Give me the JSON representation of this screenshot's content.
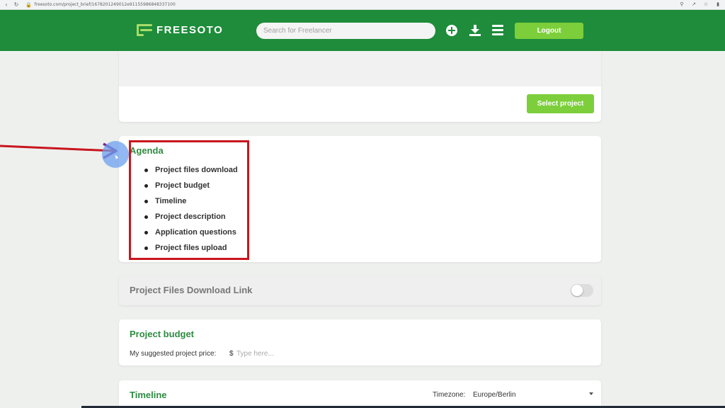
{
  "browser": {
    "url": "freesoto.com/project_brief/1678201249012e91155986848337100",
    "icons": [
      "back-icon",
      "reload-icon",
      "lock-icon",
      "zoom-icon",
      "share-icon",
      "star-icon",
      "sidebar-icon"
    ]
  },
  "header": {
    "logo_text": "FREESOTO",
    "search_placeholder": "Search for Freelancer",
    "logout_label": "Logout",
    "icons": [
      "plus-icon",
      "download-icon",
      "menu-icon"
    ]
  },
  "top_card": {
    "select_project_label": "Select project"
  },
  "agenda": {
    "title": "Agenda",
    "items": [
      "Project files download",
      "Project budget",
      "Timeline",
      "Project description",
      "Application questions",
      "Project files upload"
    ]
  },
  "download_link": {
    "title": "Project Files Download Link",
    "toggle_on": false
  },
  "budget": {
    "title": "Project budget",
    "price_label": "My suggested project price:",
    "currency": "$",
    "price_placeholder": "Type here..."
  },
  "timeline": {
    "title": "Timeline",
    "timezone_label": "Timezone:",
    "timezone_value": "Europe/Berlin"
  },
  "colors": {
    "brand_green": "#1e8c3a",
    "accent_lime": "#7ccf3a",
    "heading_green": "#2e8b40",
    "annotation_red": "#c8151d"
  }
}
